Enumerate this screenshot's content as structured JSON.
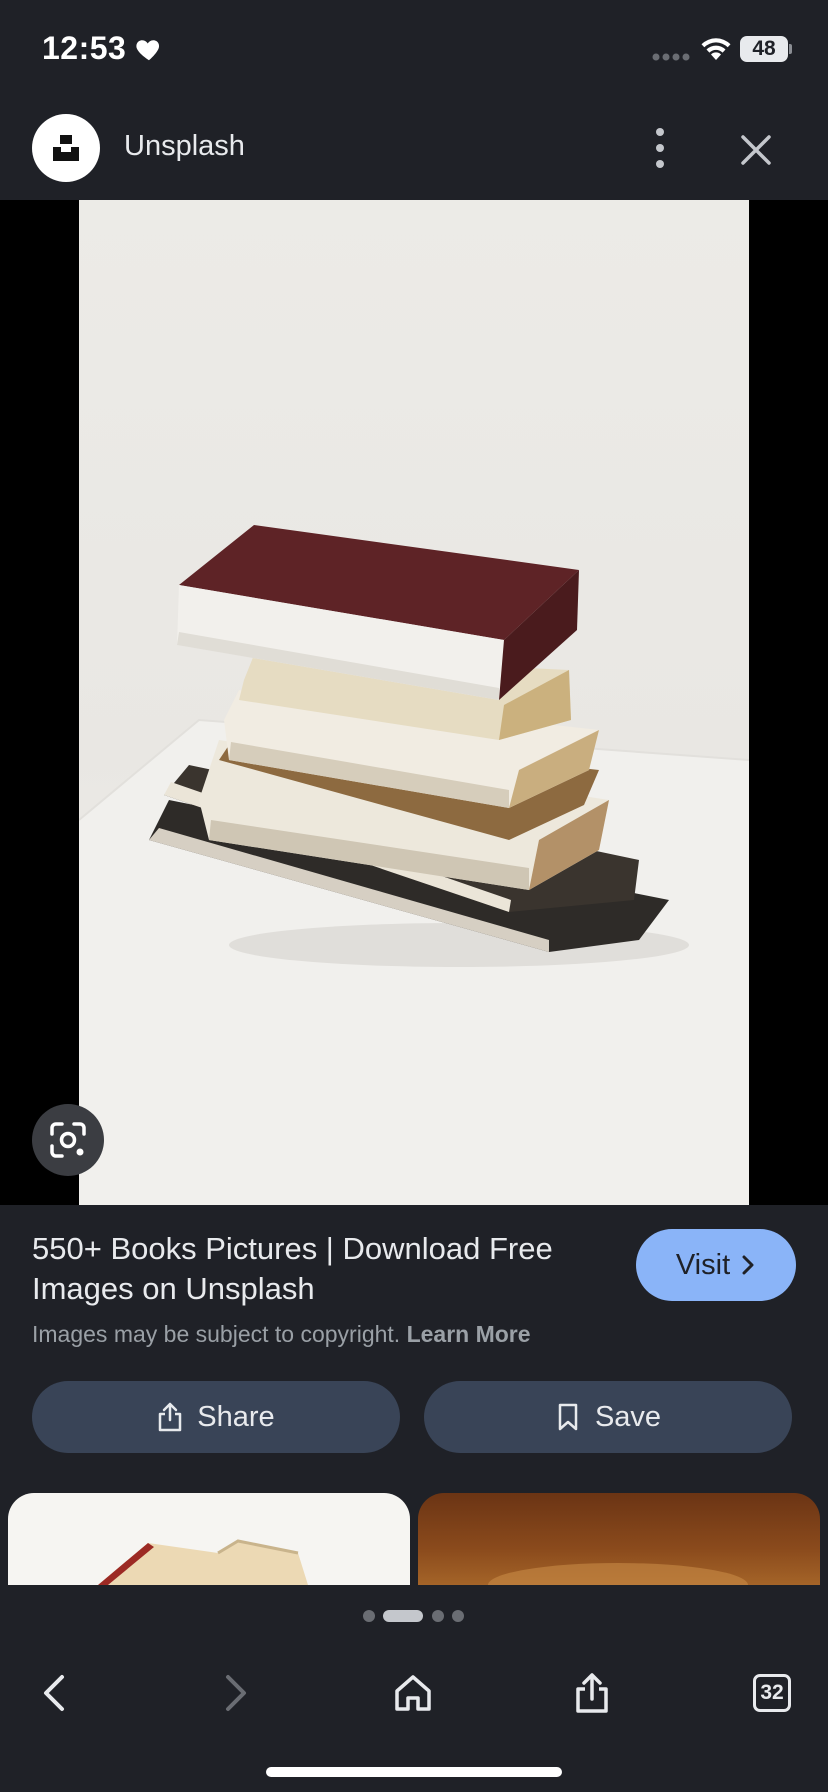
{
  "status_bar": {
    "time": "12:53",
    "battery": "48",
    "icons": [
      "heart-icon",
      "signal-icon",
      "wifi-icon",
      "battery-icon"
    ]
  },
  "header": {
    "site_name": "Unsplash",
    "icons": [
      "unsplash-logo-icon",
      "more-vert-icon",
      "close-icon"
    ]
  },
  "image": {
    "lens_icon": "google-lens-icon"
  },
  "result": {
    "title": "550+ Books Pictures | Download Free Images on Unsplash",
    "visit_label": "Visit",
    "copyright_text": "Images may be subject to copyright.",
    "learn_more_label": "Learn More",
    "share_label": "Share",
    "save_label": "Save"
  },
  "bottom_bar": {
    "tab_count": "32",
    "icons": [
      "back-icon",
      "forward-icon",
      "home-icon",
      "share-icon",
      "tabs-icon"
    ]
  },
  "colors": {
    "background": "#1f2127",
    "accent": "#8ab4f8",
    "pill_button": "#394457"
  }
}
